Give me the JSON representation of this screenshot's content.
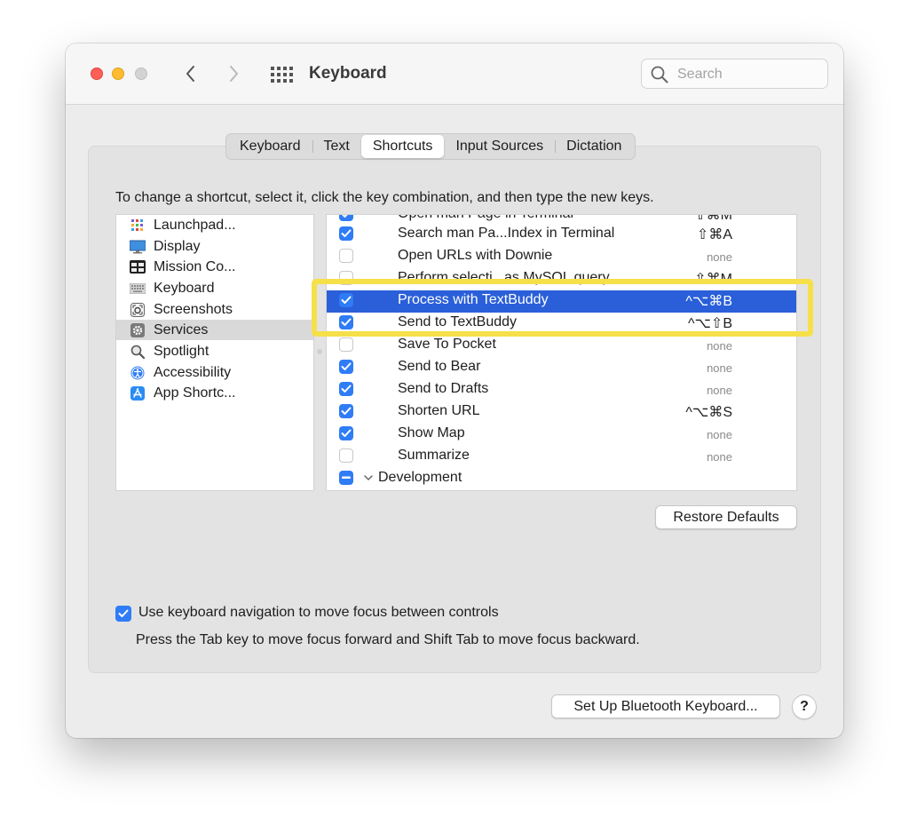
{
  "window": {
    "title": "Keyboard"
  },
  "search": {
    "placeholder": "Search"
  },
  "tabs": [
    {
      "label": "Keyboard",
      "active": false
    },
    {
      "label": "Text",
      "active": false
    },
    {
      "label": "Shortcuts",
      "active": true
    },
    {
      "label": "Input Sources",
      "active": false
    },
    {
      "label": "Dictation",
      "active": false
    }
  ],
  "instructions": "To change a shortcut, select it, click the key combination, and then type the new keys.",
  "categories": [
    {
      "label": "Launchpad...",
      "icon": "launchpad-icon"
    },
    {
      "label": "Display",
      "icon": "display-icon"
    },
    {
      "label": "Mission Co...",
      "icon": "mission-control-icon"
    },
    {
      "label": "Keyboard",
      "icon": "keyboard-icon"
    },
    {
      "label": "Screenshots",
      "icon": "screenshot-icon"
    },
    {
      "label": "Services",
      "icon": "gear-icon",
      "selected": true
    },
    {
      "label": "Spotlight",
      "icon": "magnifier-icon"
    },
    {
      "label": "Accessibility",
      "icon": "accessibility-icon"
    },
    {
      "label": "App Shortc...",
      "icon": "app-store-icon"
    }
  ],
  "services": [
    {
      "name": "Open man Page in Terminal",
      "shortcut": "⇧⌘M",
      "checked": true,
      "partial": "top"
    },
    {
      "name": "Search man Pa...Index in Terminal",
      "shortcut": "⇧⌘A",
      "checked": true
    },
    {
      "name": "Open URLs with Downie",
      "shortcut": "none",
      "checked": false
    },
    {
      "name": "Perform selecti...as MySQL query",
      "shortcut": "⇧⌘M",
      "checked": false,
      "partial": "bottom"
    },
    {
      "name": "Process with TextBuddy",
      "shortcut": "^⌥⌘B",
      "checked": true,
      "selected": true
    },
    {
      "name": "Send to TextBuddy",
      "shortcut": "^⌥⇧B",
      "checked": true
    },
    {
      "name": "Save To Pocket",
      "shortcut": "none",
      "checked": false
    },
    {
      "name": "Send to Bear",
      "shortcut": "none",
      "checked": true
    },
    {
      "name": "Send to Drafts",
      "shortcut": "none",
      "checked": true
    },
    {
      "name": "Shorten URL",
      "shortcut": "^⌥⌘S",
      "checked": true
    },
    {
      "name": "Show Map",
      "shortcut": "none",
      "checked": true
    },
    {
      "name": "Summarize",
      "shortcut": "none",
      "checked": false
    },
    {
      "name": "Development",
      "shortcut": "",
      "checked": "mixed",
      "group": true
    }
  ],
  "buttons": {
    "restore_defaults": "Restore Defaults",
    "bluetooth": "Set Up Bluetooth Keyboard...",
    "help": "?"
  },
  "keyboard_navigation": {
    "label": "Use keyboard navigation to move focus between controls",
    "checked": true,
    "hint": "Press the Tab key to move focus forward and Shift Tab to move focus backward."
  },
  "colors": {
    "accent": "#2f7cf6",
    "selection": "#2a5fd9",
    "highlight_frame": "#f5e04a"
  }
}
